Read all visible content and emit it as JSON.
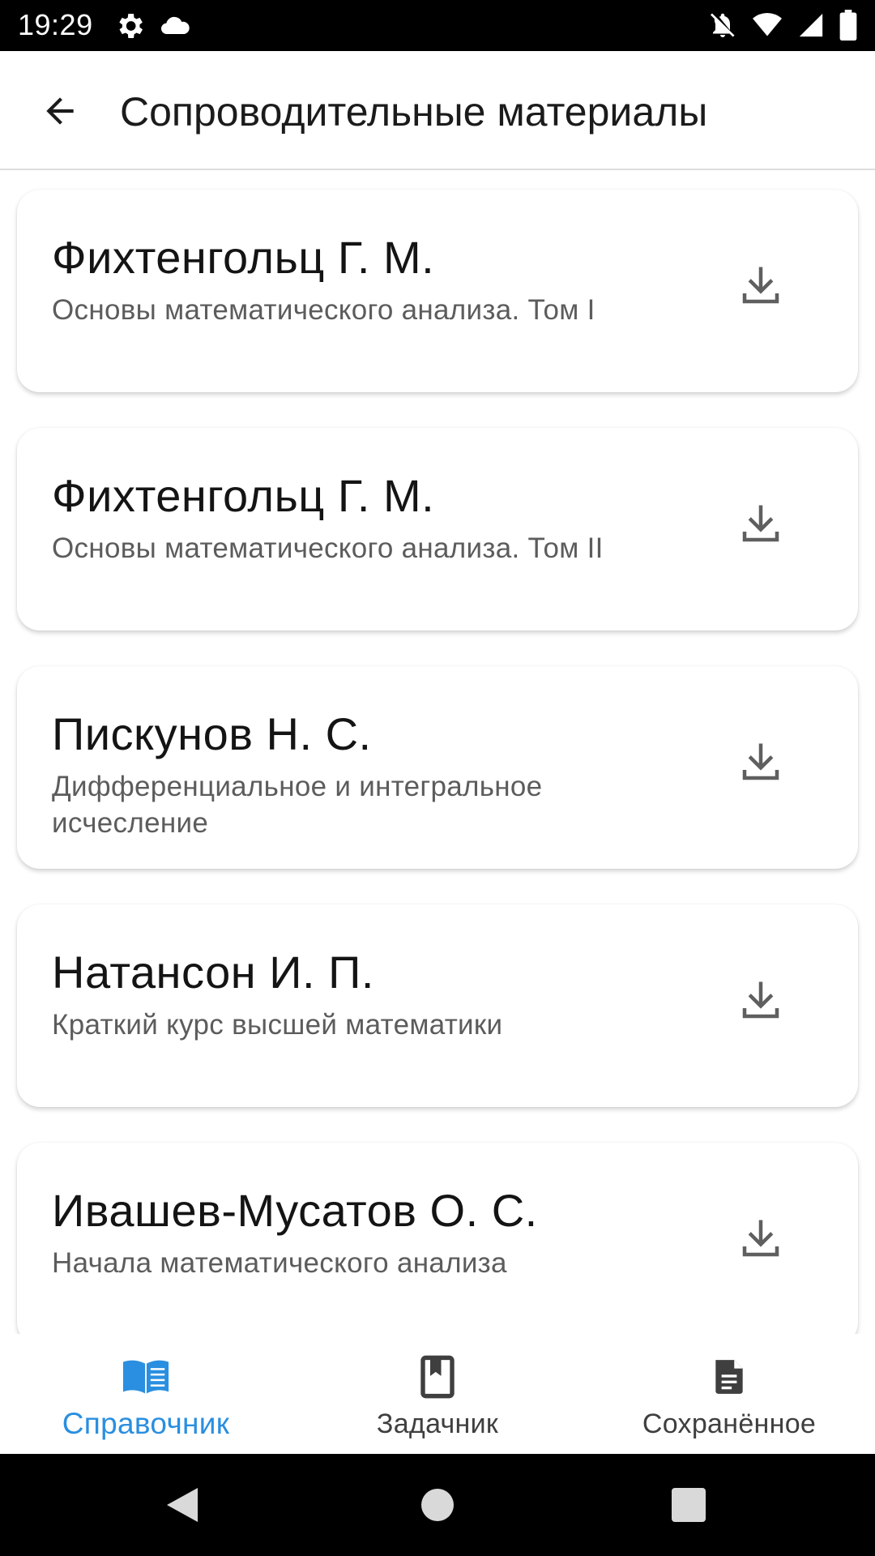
{
  "status_bar": {
    "time": "19:29"
  },
  "app_bar": {
    "title": "Сопроводительные материалы"
  },
  "materials": [
    {
      "author": "Фихтенгольц Г. М.",
      "book": "Основы математического анализа. Том I"
    },
    {
      "author": "Фихтенгольц Г. М.",
      "book": "Основы математического анализа. Том II"
    },
    {
      "author": "Пискунов Н. С.",
      "book": "Дифференциальное и интегральное исчесление"
    },
    {
      "author": "Натансон И. П.",
      "book": "Краткий курс высшей математики"
    },
    {
      "author": "Ивашев-Мусатов О. С.",
      "book": "Начала математического анализа"
    }
  ],
  "bottom_nav": {
    "items": [
      {
        "label": "Справочник",
        "icon": "open-book-icon",
        "active": true
      },
      {
        "label": "Задачник",
        "icon": "bookmark-book-icon",
        "active": false
      },
      {
        "label": "Сохранённое",
        "icon": "document-icon",
        "active": false
      }
    ]
  },
  "colors": {
    "accent": "#2a8fe0",
    "secondary_text": "#5c5c5c",
    "icon_gray": "#5f5f5f"
  }
}
